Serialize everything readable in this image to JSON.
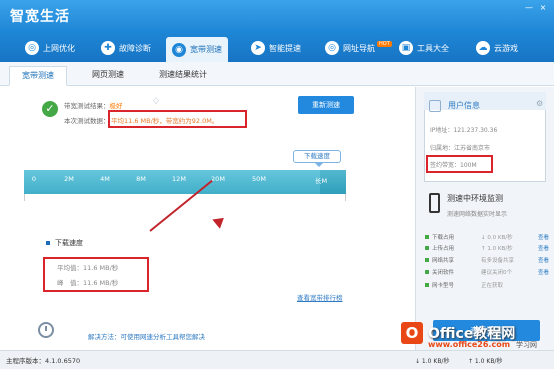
{
  "app": {
    "title": "智宽生活",
    "minimize": "—",
    "close": "×"
  },
  "nav": [
    {
      "label": "上网优化",
      "icon": "globe-icon",
      "symbol": "◎"
    },
    {
      "label": "故障诊断",
      "icon": "diagnosis-icon",
      "symbol": "✚"
    },
    {
      "label": "宽带测速",
      "icon": "speed-test-icon",
      "symbol": "◉"
    },
    {
      "label": "智能提速",
      "icon": "boost-icon",
      "symbol": "➤"
    },
    {
      "label": "网址导航",
      "icon": "navigation-icon",
      "symbol": "◎"
    },
    {
      "label": "工具大全",
      "icon": "tools-icon",
      "symbol": "▣"
    },
    {
      "label": "云游戏",
      "icon": "cloud-game-icon",
      "symbol": "☁"
    }
  ],
  "nav_badge": "HOT",
  "tabs": [
    "宽带测速",
    "网页测速",
    "测速结果统计"
  ],
  "result": {
    "label": "带宽测试结果：",
    "grade": "极好",
    "data_label": "本次测试数据：",
    "measured": "平均11.6 MB/秒，带宽约为92.0M。",
    "retest": "重新测速"
  },
  "gauge": {
    "bubble": "下载速度",
    "ticks": [
      "0",
      "2M",
      "4M",
      "8M",
      "12M",
      "20M",
      "50M",
      "长M"
    ],
    "fill_fraction": 0.92
  },
  "download": {
    "title": "下载速度",
    "average": "平均值：11.6 MB/秒",
    "peak": "峰　值：11.6 MB/秒",
    "ranking_link": "查看宽带排行榜"
  },
  "solution": "解决方法：可使用网速分析工具帮您解决",
  "user": {
    "title": "用户信息",
    "ip": "IP地址：121.237.30.36",
    "location": "归属地：江苏省南京市",
    "contracted_bandwidth": "签约带宽：100M"
  },
  "monitor": {
    "title": "测速中环境监测",
    "description": "测速网络数据实时显示",
    "rows": [
      {
        "label": "下载占用",
        "value": "↓ 0.0 KB/秒",
        "link": "查看"
      },
      {
        "label": "上传占用",
        "value": "↑ 1.0 KB/秒",
        "link": "查看"
      },
      {
        "label": "网络共享",
        "value": "有多设备共享",
        "link": "查看"
      },
      {
        "label": "关闭软件",
        "value": "建议关闭0个",
        "link": "查看"
      },
      {
        "label": "网卡型号",
        "value": "正在获取",
        "link": ""
      }
    ],
    "button": "查看监测"
  },
  "status": {
    "version": "主程序版本：4.1.0.6570",
    "download": "↓ 1.0 KB/秒",
    "upload": "↑ 1.0 KB/秒"
  },
  "watermark": {
    "logo": "O",
    "brand": "Office教程网",
    "site": "www.office26.com",
    "corner": "学习网"
  }
}
